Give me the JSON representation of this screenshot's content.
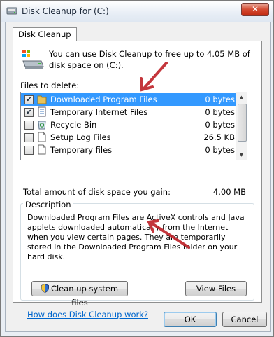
{
  "window": {
    "title": "Disk Cleanup for  (C:)",
    "close_symbol": "✕"
  },
  "tab": {
    "label": "Disk Cleanup"
  },
  "intro": {
    "text": "You can use Disk Cleanup to free up to 4.05 MB of disk space on  (C:)."
  },
  "files": {
    "label": "Files to delete:",
    "items": [
      {
        "checked": true,
        "name": "Downloaded Program Files",
        "size": "0 bytes",
        "icon": "folder-icon",
        "selected": true
      },
      {
        "checked": true,
        "name": "Temporary Internet Files",
        "size": "0 bytes",
        "icon": "document-icon",
        "selected": false
      },
      {
        "checked": false,
        "name": "Recycle Bin",
        "size": "0 bytes",
        "icon": "recycle-bin-icon",
        "selected": false
      },
      {
        "checked": false,
        "name": "Setup Log Files",
        "size": "26.5 KB",
        "icon": "file-icon",
        "selected": false
      },
      {
        "checked": false,
        "name": "Temporary files",
        "size": "0 bytes",
        "icon": "file-icon",
        "selected": false
      }
    ]
  },
  "total": {
    "label": "Total amount of disk space you gain:",
    "value": "4.00 MB"
  },
  "description": {
    "label": "Description",
    "text": "Downloaded Program Files are ActiveX controls and Java applets downloaded automatically from the Internet when you view certain pages. They are temporarily stored in the Downloaded Program Files folder on your hard disk."
  },
  "buttons": {
    "cleanup": "Clean up system files",
    "view_files": "View Files",
    "ok": "OK",
    "cancel": "Cancel"
  },
  "help_link": "How does Disk Cleanup work?",
  "colors": {
    "selection": "#3399ff",
    "annotation_arrow": "#c0262c",
    "link": "#0066cc"
  }
}
